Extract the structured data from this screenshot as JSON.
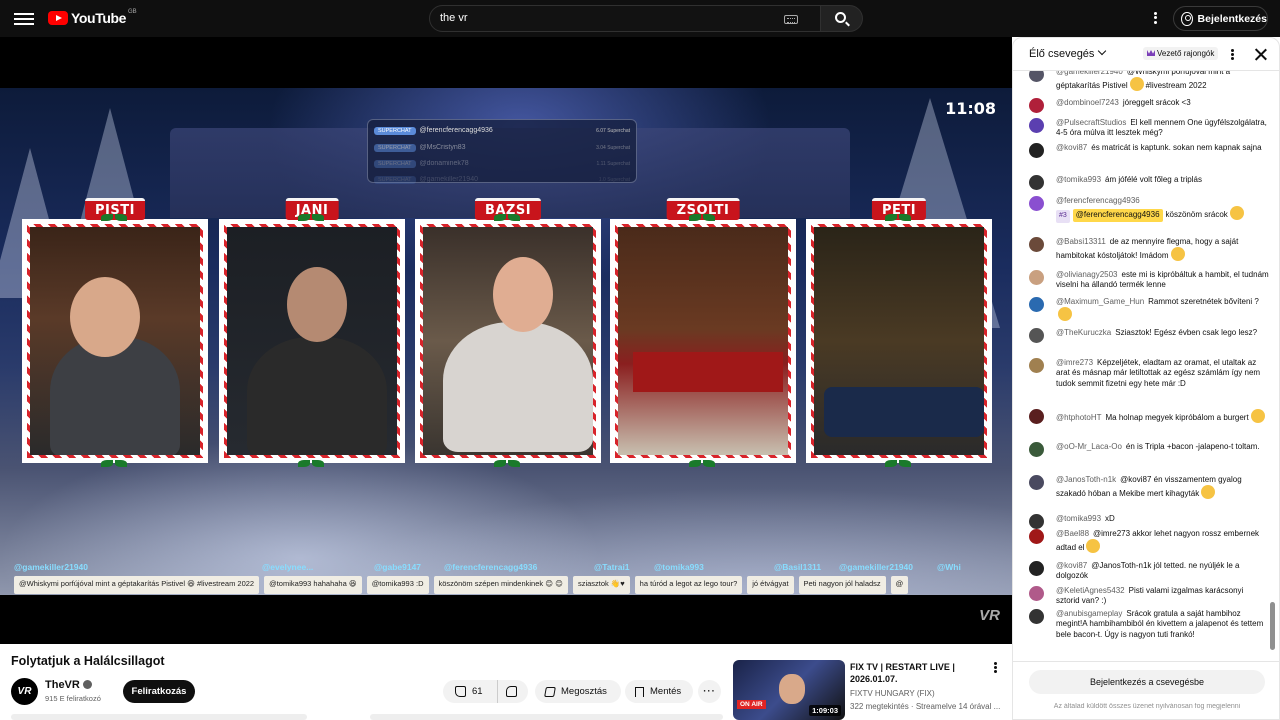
{
  "topbar": {
    "logo_text": "YouTube",
    "region": "GB",
    "search_value": "the vr",
    "signin_label": "Bejelentkezés"
  },
  "player": {
    "clock": "11:08",
    "superchat": {
      "badge": "SUPERCHAT",
      "top_name": "@ferencferencagg4936",
      "top_amount": "6.07 Superchat",
      "rows": [
        {
          "badge": "SUPERCHAT",
          "name": "@MsCristyn83",
          "amount": "3.04 Superchat"
        },
        {
          "badge": "SUPERCHAT",
          "name": "@donaminek78",
          "amount": "1.11 Superchat"
        },
        {
          "badge": "SUPERCHAT",
          "name": "@gamekiller21940",
          "amount": "1.0 Superchat"
        }
      ]
    },
    "cams": [
      "PISTI",
      "JANI",
      "BAZSI",
      "ZSOLTI",
      "PETI"
    ],
    "strip_names": [
      "@gamekiller21940",
      "@evelynee...",
      "@gabe9147",
      "@ferencferencagg4936",
      "@Tatrai1",
      "@tomika993",
      "@Basil1311",
      "@gamekiller21940",
      "@Whi"
    ],
    "strip_msgs": [
      "@Whiskymi porfújóval mint a géptakarítás Pistivel 😆 #livestream 2022",
      "@tomika993 hahahaha 😆",
      "@tomika993 :D",
      "köszönöm szépen mindenkinek 😊 😊",
      "sziasztok 👋♥",
      "ha túród a legot az lego tour?",
      "jó étvágyat",
      "Peti nagyon jól haladsz",
      "@"
    ],
    "watermark": "VR"
  },
  "video": {
    "title": "Folytatjuk a Halálcsillagot",
    "channel": "TheVR",
    "avatar_text": "VR",
    "subs": "915 E feliratkozó",
    "subscribe": "Feliratkozás",
    "likes": "61",
    "share": "Megosztás",
    "save": "Mentés",
    "more": "···"
  },
  "recommendation": {
    "title": "FIX TV | RESTART LIVE | 2026.01.07.",
    "channel": "FIXTV HUNGARY (FIX)",
    "meta": "322 megtekintés · Streamelve 14 órával ...",
    "duration": "1:09:03",
    "onair": "ON AIR"
  },
  "chat": {
    "title": "Élő csevegés",
    "top_fans": "Vezető rajongók",
    "messages": [
      {
        "name": "@gamekiller21940",
        "text": "@Whiskymi porfújóval mint a géptakarítás Pistivel",
        "emoji": true,
        "extra": "#livestream 2022",
        "color": "#556"
      },
      {
        "name": "@dombinoel7243",
        "text": "jóreggelt srácok <3",
        "color": "#b0203a"
      },
      {
        "name": "@PulsecraftStudios",
        "text": "El kell mennem One ügyfélszolgálatra, 4-5 óra múlva itt lesztek még?",
        "color": "#5b3fb0"
      },
      {
        "name": "@kovi87",
        "text": "és matricát is kaptunk. sokan nem kapnak sajna",
        "color": "#222"
      },
      {
        "name": "@tomika993",
        "text": "ám jófélé volt főleg a triplás",
        "color": "#333"
      },
      {
        "name": "@ferencferencagg4936",
        "badge": "#3",
        "mention": "@ferencferencagg4936",
        "text": "köszönöm srácok",
        "emoji": true,
        "color": "#8a4fd0"
      },
      {
        "name": "@Babsi13311",
        "text": "de az mennyire flegma, hogy a saját hambitokat kóstoljátok! Imádom",
        "emoji": true,
        "color": "#6b4a3a"
      },
      {
        "name": "@olivianagy2503",
        "text": "este mi is kipróbáltuk a hambit, el tudnám viselni ha állandó termék lenne",
        "color": "#c9a080"
      },
      {
        "name": "@Maximum_Game_Hun",
        "text": "Rammot szeretnétek bővíteni ?",
        "emoji": true,
        "color": "#2a6ab0"
      },
      {
        "name": "@TheKuruczka",
        "text": "Sziasztok! Egész évben csak lego lesz?",
        "color": "#555"
      },
      {
        "name": "@imre273",
        "text": "Képzeljétek, eladtam az oramat, el utaltak az arat és másnap már letiltottak az egész számlám így nem tudok semmit fizetni egy hete már :D",
        "color": "#a08050"
      },
      {
        "name": "@htphotoHT",
        "text": "Ma holnap megyek kipróbálom a burgert",
        "emoji": true,
        "color": "#5a1f1f"
      },
      {
        "name": "@oO-Mr_Laca-Oo",
        "text": "én is Tripla +bacon -jalapeno-t toltam.",
        "color": "#3a5a3a"
      },
      {
        "name": "@JanosToth-n1k",
        "text": "@kovi87 én visszamentem gyalog szakadó hóban a Mekibe mert kihagyták",
        "emoji": true,
        "color": "#4a4a60"
      },
      {
        "name": "@tomika993",
        "text": "xD",
        "color": "#333"
      },
      {
        "name": "@Bael88",
        "text": "@imre273 akkor lehet nagyon rossz embernek adtad el",
        "emoji": true,
        "color": "#a01818"
      },
      {
        "name": "@kovi87",
        "text": "@JanosToth-n1k jól tetted. ne nyúljék le a dolgozók",
        "color": "#222"
      },
      {
        "name": "@KeletiAgnes5432",
        "text": "Pisti valami izgalmas karácsonyi sztorid van? :)",
        "color": "#b05a8a"
      },
      {
        "name": "@anubisgameplay",
        "text": "Srácok gratula a saját hambihoz megint!A hambihambiból én kivettem a jalapenot és tettem bele bacon-t. Úgy is nagyon tuti frankó!",
        "color": "#333"
      }
    ],
    "login_button": "Bejelentkezés a csevegésbe",
    "note": "Az általad küldött összes üzenet nyilvánosan fog megjelenni"
  }
}
